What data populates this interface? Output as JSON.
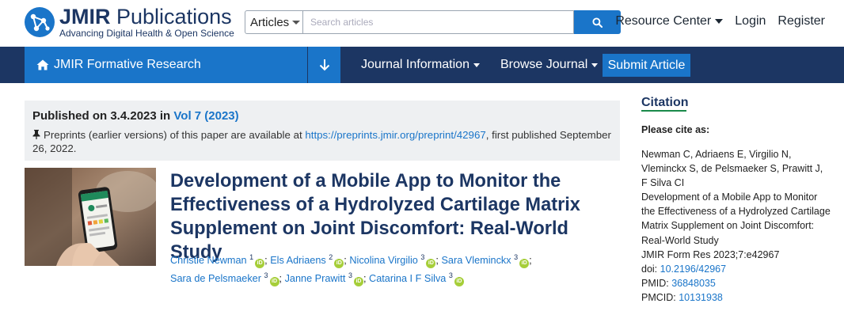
{
  "brand": {
    "name_bold": "JMIR",
    "name_rest": " Publications",
    "tagline": "Advancing Digital Health & Open Science",
    "logo_icon": "jmir-network-logo-icon"
  },
  "search": {
    "scope": "Articles",
    "placeholder": "Search articles",
    "button_icon": "search-icon"
  },
  "toplinks": {
    "resource_center": "Resource Center",
    "login": "Login",
    "register": "Register"
  },
  "nav": {
    "journal": "JMIR Formative Research",
    "journal_info": "Journal Information",
    "browse": "Browse Journal",
    "submit": "Submit Article"
  },
  "publication": {
    "published_prefix": "Published on 3.4.2023 in ",
    "volume": "Vol 7 (2023)",
    "preprint_prefix": "Preprints (earlier versions) of this paper are available at ",
    "preprint_url": "https://preprints.jmir.org/preprint/42967",
    "preprint_suffix": ", first published September 26, 2022."
  },
  "article": {
    "title": "Development of a Mobile App to Monitor the Effectiveness of a Hydrolyzed Cartilage Matrix Supplement on Joint Discomfort: Real-World Study",
    "authors": [
      {
        "name": "Christie Newman",
        "aff": "1"
      },
      {
        "name": "Els Adriaens",
        "aff": "2"
      },
      {
        "name": "Nicolina Virgilio",
        "aff": "3"
      },
      {
        "name": "Sara Vleminckx",
        "aff": "3"
      },
      {
        "name": "Sara de Pelsmaeker",
        "aff": "3"
      },
      {
        "name": "Janne Prawitt",
        "aff": "3"
      },
      {
        "name": "Catarina I F Silva",
        "aff": "3"
      }
    ],
    "orcid_label": "iD"
  },
  "citation": {
    "heading": "Citation",
    "please_cite": "Please cite as:",
    "authors": "Newman C, Adriaens E, Virgilio N, Vleminckx S, de Pelsmaeker S, Prawitt J, F Silva CI",
    "title": "Development of a Mobile App to Monitor the Effectiveness of a Hydrolyzed Cartilage Matrix Supplement on Joint Discomfort: Real-World Study",
    "journal_ref": "JMIR Form Res 2023;7:e42967",
    "doi_label": "doi: ",
    "doi": "10.2196/42967",
    "pmid_label": "PMID: ",
    "pmid": "36848035",
    "pmcid_label": "PMCID: ",
    "pmcid": "10131938"
  },
  "colors": {
    "navy": "#1c3663",
    "accent_blue": "#1a75c9",
    "orcid_green": "#a6ce39",
    "citation_underline": "#1a8a4a"
  }
}
